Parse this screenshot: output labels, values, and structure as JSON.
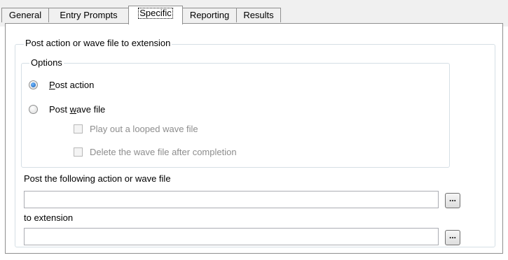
{
  "tabs": [
    {
      "label": "General"
    },
    {
      "label": "Entry Prompts"
    },
    {
      "label": "Specific"
    },
    {
      "label": "Reporting"
    },
    {
      "label": "Results"
    }
  ],
  "active_tab": "Specific",
  "group": {
    "caption": "Post action or wave file to extension",
    "options": {
      "caption": "Options",
      "radio_post_action": {
        "mnemonic": "P",
        "rest": "ost action",
        "checked": true
      },
      "radio_post_wave_file": {
        "before": "Post ",
        "mnemonic": "w",
        "rest": "ave file",
        "checked": false
      },
      "check_loop": {
        "label": "Play out a looped wave file",
        "checked": false,
        "enabled": false
      },
      "check_delete": {
        "label": "Delete the wave file after completion",
        "checked": false,
        "enabled": false
      }
    },
    "action_field": {
      "label": "Post the following action or wave file",
      "value": "",
      "browse_label": "..."
    },
    "extension_field": {
      "label": "to extension",
      "value": "",
      "browse_label": "..."
    }
  }
}
